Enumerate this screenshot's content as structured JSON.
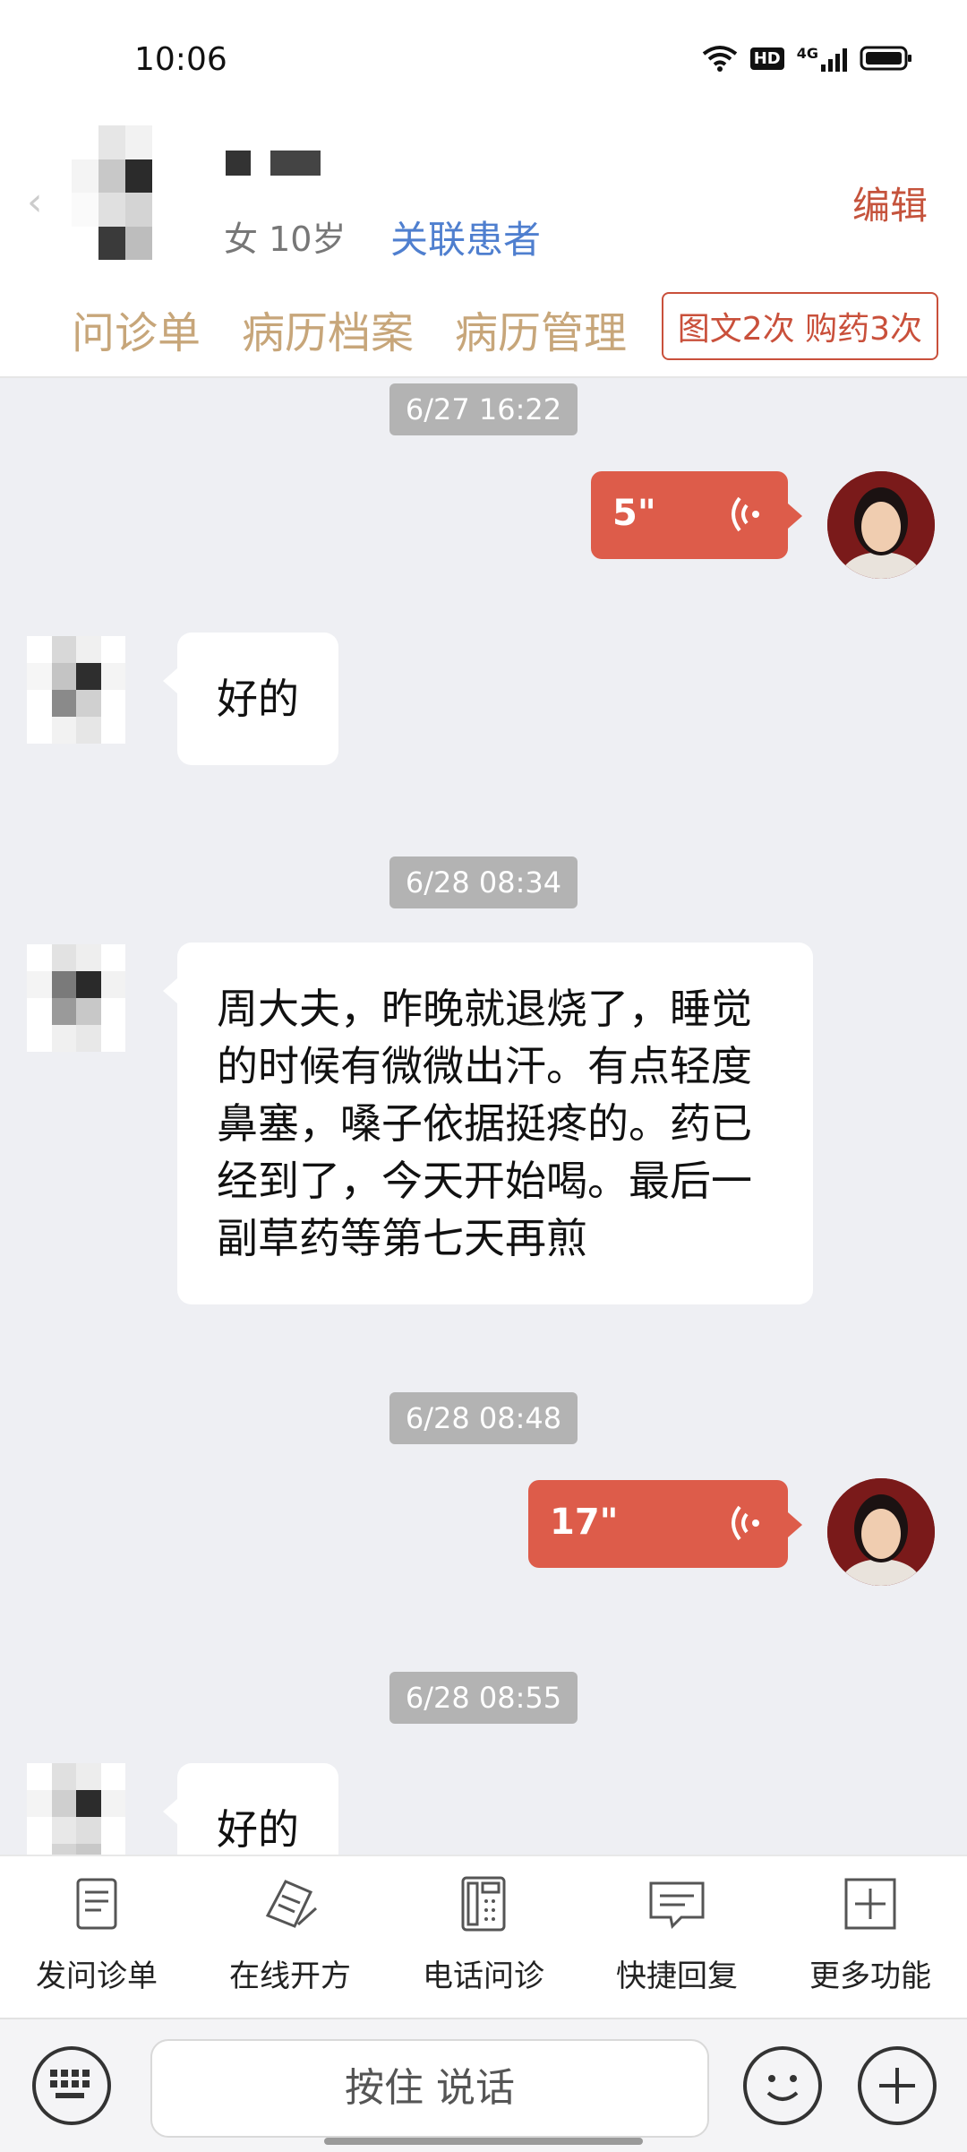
{
  "status_bar": {
    "time": "10:06",
    "network": "4G",
    "hd": "HD"
  },
  "header": {
    "patient_info": "女 10岁",
    "link_patient": "关联患者",
    "edit": "编辑",
    "tabs": [
      "问诊单",
      "病历档案",
      "病历管理"
    ],
    "count_badge": "图文2次 购药3次"
  },
  "messages": {
    "ts1": "6/27 16:22",
    "voice1_duration": "5\"",
    "text1": "好的",
    "ts2": "6/28 08:34",
    "text2": "周大夫，昨晚就退烧了，睡觉的时候有微微出汗。有点轻度鼻塞，嗓子依据挺疼的。药已经到了，今天开始喝。最后一副草药等第七天再煎",
    "ts3": "6/28 08:48",
    "voice2_duration": "17\"",
    "ts4": "6/28 08:55",
    "text3": "好的"
  },
  "toolbar": {
    "items": [
      "发问诊单",
      "在线开方",
      "电话问诊",
      "快捷回复",
      "更多功能"
    ]
  },
  "input": {
    "talk_label": "按住 说话"
  },
  "icons": {
    "keyboard": "keyboard-icon",
    "emoji": "emoji-icon",
    "add": "plus-circle-icon"
  },
  "colors": {
    "accent_red": "#dd5c4a",
    "tab_tan": "#c7a67a",
    "link_blue": "#4f7fcf"
  }
}
